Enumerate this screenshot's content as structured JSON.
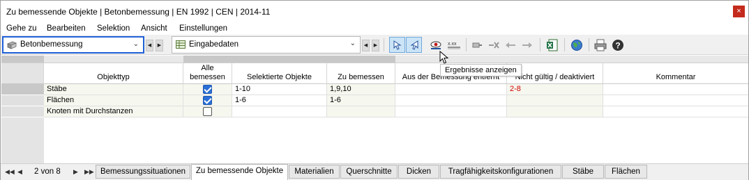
{
  "window": {
    "title": "Zu bemessende Objekte | Betonbemessung | EN 1992 | CEN | 2014-11",
    "close_glyph": "×"
  },
  "menu": [
    "Gehe zu",
    "Bearbeiten",
    "Selektion",
    "Ansicht",
    "Einstellungen"
  ],
  "toolbar": {
    "module_combo": "Betonbemessung",
    "data_combo": "Eingabedaten",
    "tooltip": "Ergebnisse anzeigen"
  },
  "table": {
    "headers": {
      "objekttyp": "Objekttyp",
      "alle_bemessen": "Alle bemessen",
      "selektierte": "Selektierte Objekte",
      "zu_bemessen": "Zu bemessen",
      "entfernt": "Aus der Bemessung entfernt",
      "nicht_gueltig": "Nicht gültig / deaktiviert",
      "kommentar": "Kommentar"
    },
    "rows": [
      {
        "objekttyp": "Stäbe",
        "alle": true,
        "selektierte": "1-10",
        "zu_bemessen": "1,9,10",
        "entfernt": "",
        "nicht_gueltig": "2-8",
        "kommentar": ""
      },
      {
        "objekttyp": "Flächen",
        "alle": true,
        "selektierte": "1-6",
        "zu_bemessen": "1-6",
        "entfernt": "",
        "nicht_gueltig": "",
        "kommentar": ""
      },
      {
        "objekttyp": "Knoten mit Durchstanzen",
        "alle": false,
        "selektierte": "",
        "zu_bemessen": "",
        "entfernt": "",
        "nicht_gueltig": "",
        "kommentar": ""
      }
    ]
  },
  "tabs": {
    "page_indicator": "2 von 8",
    "items": [
      "Bemessungssituationen",
      "Zu bemessende Objekte",
      "Materialien",
      "Querschnitte",
      "Dicken",
      "Tragfähigkeitskonfigurationen",
      "Stäbe",
      "Flächen"
    ],
    "active_index": 1
  },
  "colors": {
    "focus_border": "#1f5fd6",
    "invalid_text": "#d00000",
    "checkbox_on": "#2a6fd6",
    "pressed_button": "#cce4f7"
  },
  "icons": [
    "module-icon",
    "table-icon",
    "select-objects-icon",
    "deselect-objects-icon",
    "show-results-icon",
    "xxx-icon",
    "renumber-icon",
    "delete-icon",
    "import-icon",
    "export-icon",
    "excel-icon",
    "globe-icon",
    "print-icon",
    "help-icon"
  ]
}
